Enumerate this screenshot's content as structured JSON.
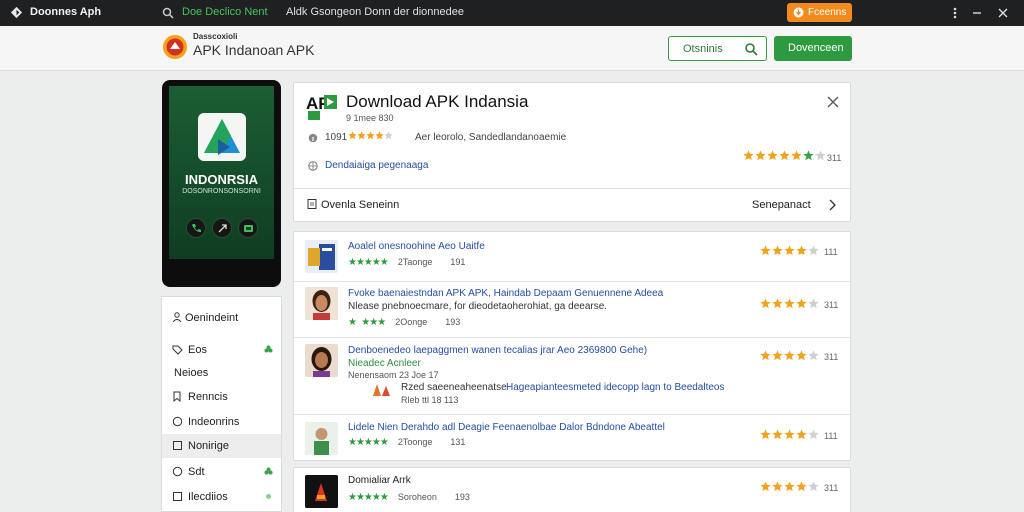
{
  "browser": {
    "title": "Doonnes Aph",
    "url_highlight": "Doe Declico Nent",
    "url_rest": "Aldk Gsongeon Donn der dionnedee",
    "action_button": "Fceenns"
  },
  "site": {
    "brand_small": "Dasscoxioli",
    "brand_title": "APK Indanoan APK",
    "search_label": "Otsninis",
    "header_button": "Dovenceen"
  },
  "phone": {
    "app_name": "INDONRSIA",
    "app_sub": "DOSONRONSONSORNI"
  },
  "menu": {
    "heading": "Oenindeint",
    "items": [
      {
        "label": "Eos"
      },
      {
        "label": "Neioes"
      },
      {
        "label": "Renncis"
      },
      {
        "label": "Indeonrins"
      },
      {
        "label": "Nonirige"
      },
      {
        "label": "Sdt"
      },
      {
        "label": "Ilecdiios"
      }
    ]
  },
  "main_card": {
    "title": "Download APK Indansia",
    "subtitle": "9 1mee 830",
    "rating_number": "1091",
    "rating_text": "Aer leorolo, Sandedlandanoaemie",
    "link_text": "Dendaiaiga pegenaaga",
    "rating_count": "311",
    "overview_label": "Ovenla Seneinn",
    "next_label": "Senepanact",
    "rating": 4.5
  },
  "list": [
    {
      "title": "Aoalel onesnoohine Aeo Uaitfe",
      "date": "2Taonge",
      "count": "191",
      "rating": 4,
      "rating_count": "111"
    },
    {
      "title": "Fvoke baenaiestndan APK APK, Haindab Depaam Genuennene Adeea",
      "desc": "Nlease pnebnoecmare, for dieodetaoherohiat, ga deearse.",
      "date": "2Oonge",
      "count": "193",
      "rating": 4,
      "rating_count": "311"
    },
    {
      "title": "Denboenedeo laepaggmen wanen tecalias jrar Aeo 2369800 Gehe)",
      "subtitle": "Nieadec Acnleer",
      "date": "Nenensaom 23 Joe 17",
      "extra1": "Rzed saeeneaheenatse",
      "extra2": "Hageapianteesmeted idecopp lagn to Beedalteos",
      "extra3": "Rleb ttl 18  113",
      "rating": 4,
      "rating_count": "311"
    },
    {
      "title": "Lidele Nien Derahdo adl Deagie Feenaenolbae Dalor Bdndone Abeattel",
      "date": "2Toonge",
      "count": "131",
      "rating": 4,
      "rating_count": "111"
    },
    {
      "title": "Domialiar Arrk",
      "date": "Soroheon",
      "count": "193",
      "rating": 4,
      "rating_count": "311"
    }
  ]
}
